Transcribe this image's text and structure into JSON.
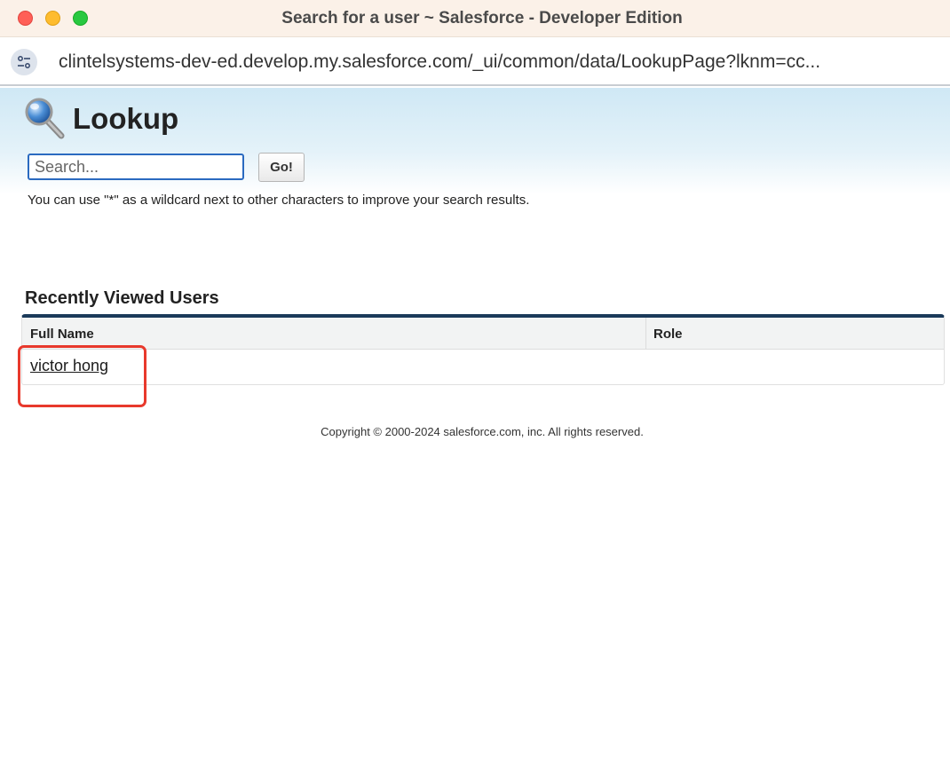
{
  "window": {
    "title": "Search for a user ~ Salesforce - Developer Edition"
  },
  "address_bar": {
    "url": "clintelsystems-dev-ed.develop.my.salesforce.com/_ui/common/data/LookupPage?lknm=cc...",
    "icon": "site-settings-icon"
  },
  "lookup": {
    "title": "Lookup",
    "icon": "magnifier-icon",
    "search": {
      "placeholder": "Search...",
      "value": ""
    },
    "go_label": "Go!",
    "hint": "You can use \"*\" as a wildcard next to other characters to improve your search results."
  },
  "recent": {
    "title": "Recently Viewed Users",
    "columns": [
      "Full Name",
      "Role"
    ],
    "rows": [
      {
        "full_name": "victor hong",
        "role": ""
      }
    ]
  },
  "footer": {
    "copyright": "Copyright © 2000-2024 salesforce.com, inc. All rights reserved."
  },
  "colors": {
    "highlight": "#e8392c",
    "panel_accent": "#1b3a5a",
    "search_border": "#2a6ac0"
  }
}
